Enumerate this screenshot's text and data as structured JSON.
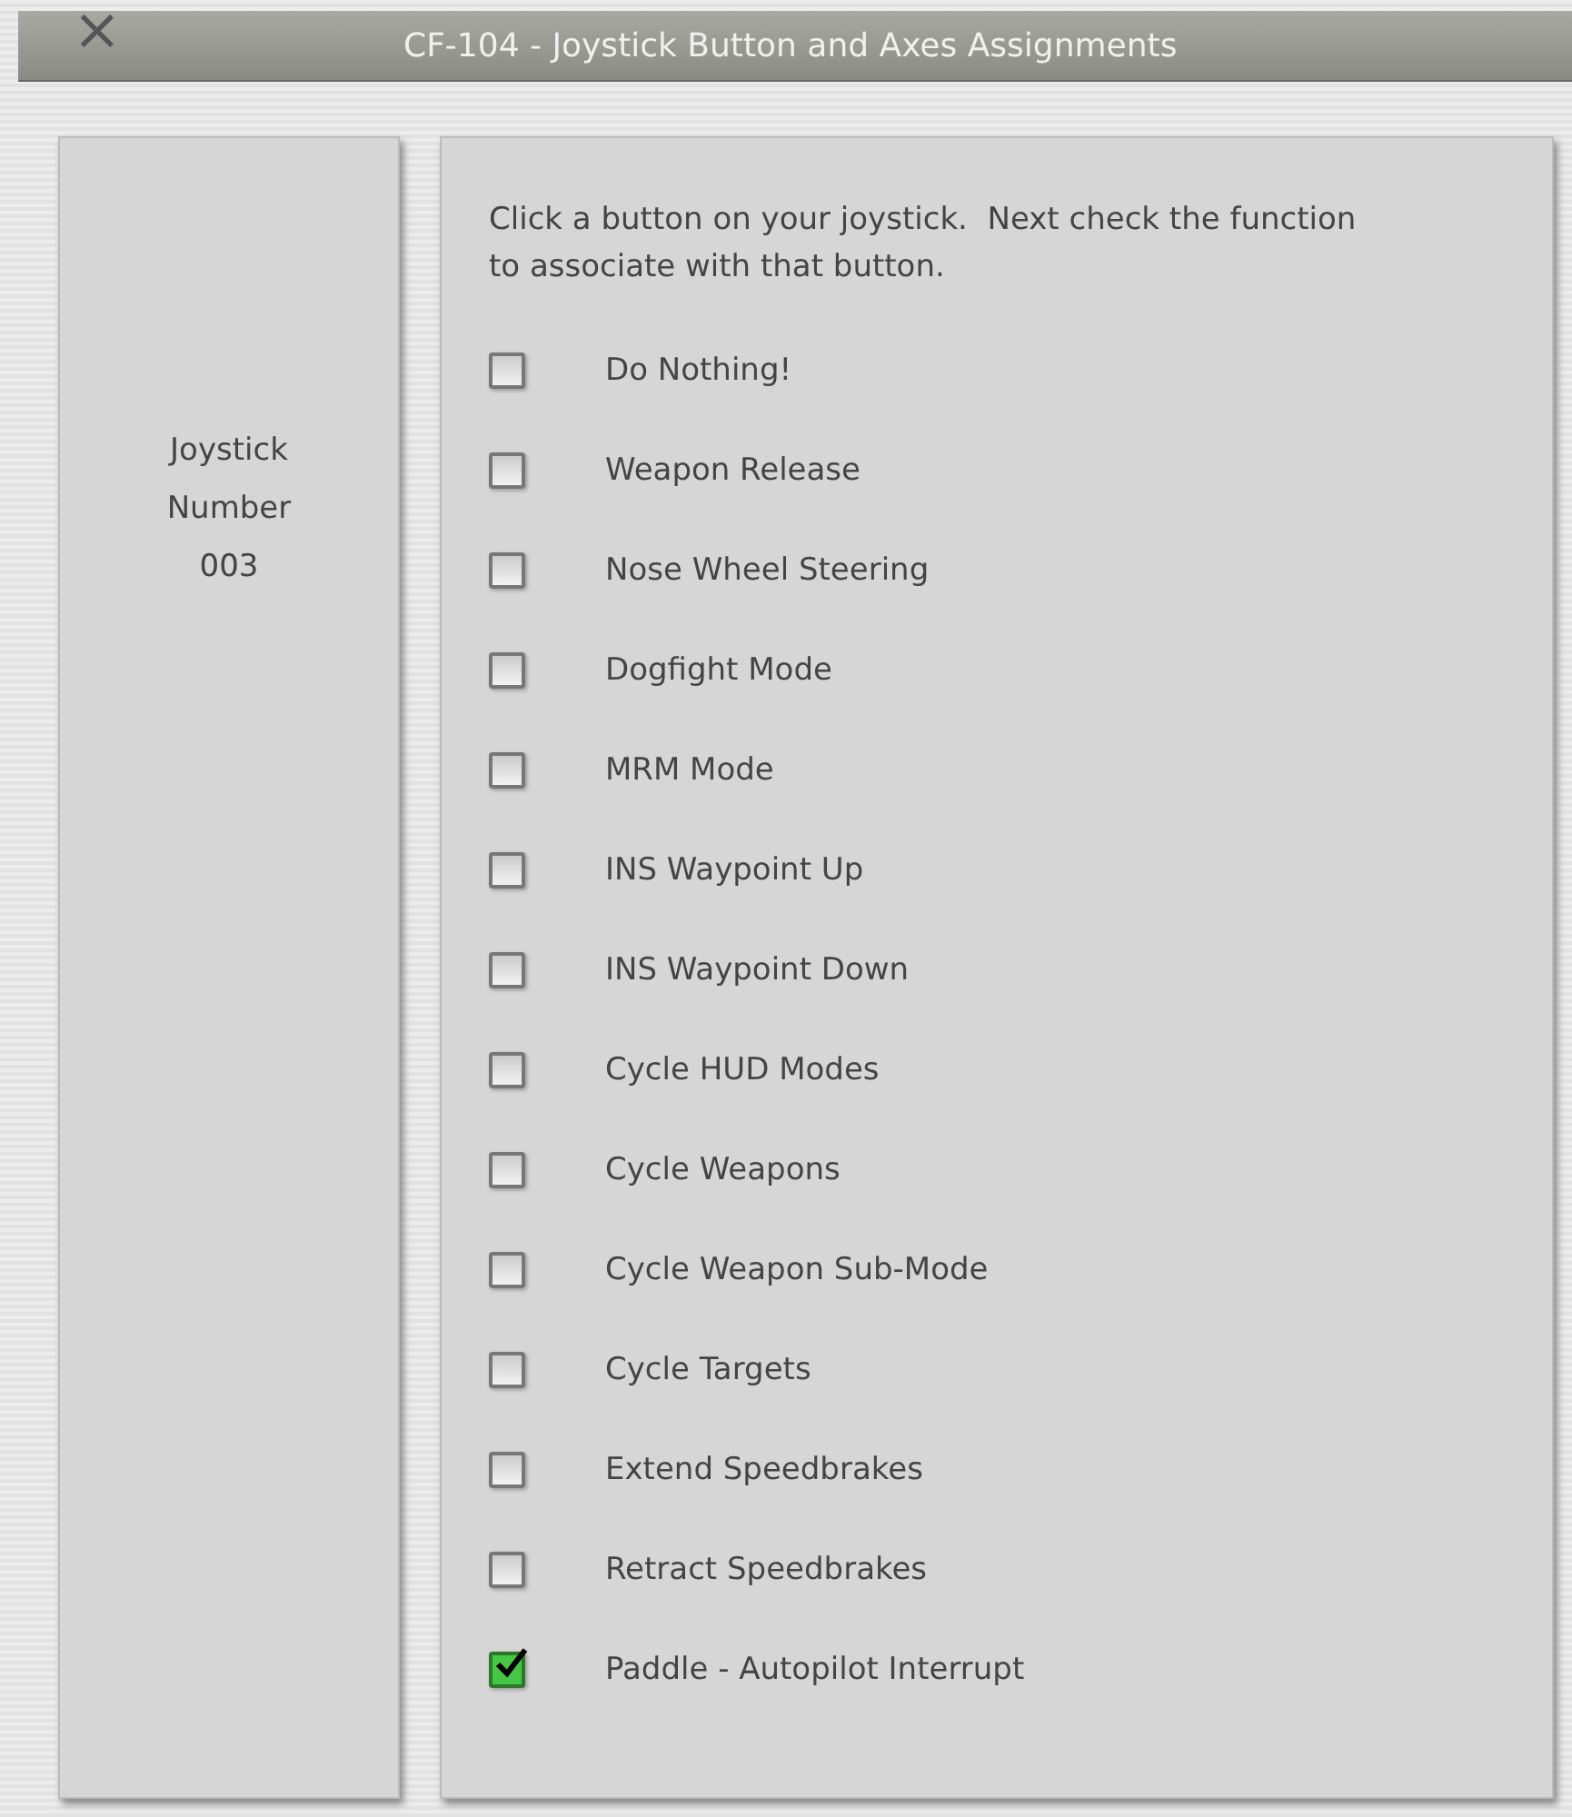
{
  "window": {
    "title": "CF-104 - Joystick Button and Axes Assignments",
    "close": "×"
  },
  "joystick": {
    "lines": [
      "Joystick",
      "Number",
      "003"
    ]
  },
  "instructions": "Click a button on your joystick.  Next check the function to associate with that button.",
  "functions": [
    {
      "label": "Do Nothing!",
      "checked": false
    },
    {
      "label": "Weapon Release",
      "checked": false
    },
    {
      "label": "Nose Wheel Steering",
      "checked": false
    },
    {
      "label": "Dogfight Mode",
      "checked": false
    },
    {
      "label": "MRM Mode",
      "checked": false
    },
    {
      "label": "INS Waypoint Up",
      "checked": false
    },
    {
      "label": "INS Waypoint Down",
      "checked": false
    },
    {
      "label": "Cycle HUD Modes",
      "checked": false
    },
    {
      "label": "Cycle Weapons",
      "checked": false
    },
    {
      "label": "Cycle Weapon Sub-Mode",
      "checked": false
    },
    {
      "label": "Cycle Targets",
      "checked": false
    },
    {
      "label": "Extend Speedbrakes",
      "checked": false
    },
    {
      "label": "Retract Speedbrakes",
      "checked": false
    },
    {
      "label": "Paddle - Autopilot Interrupt",
      "checked": true
    }
  ]
}
